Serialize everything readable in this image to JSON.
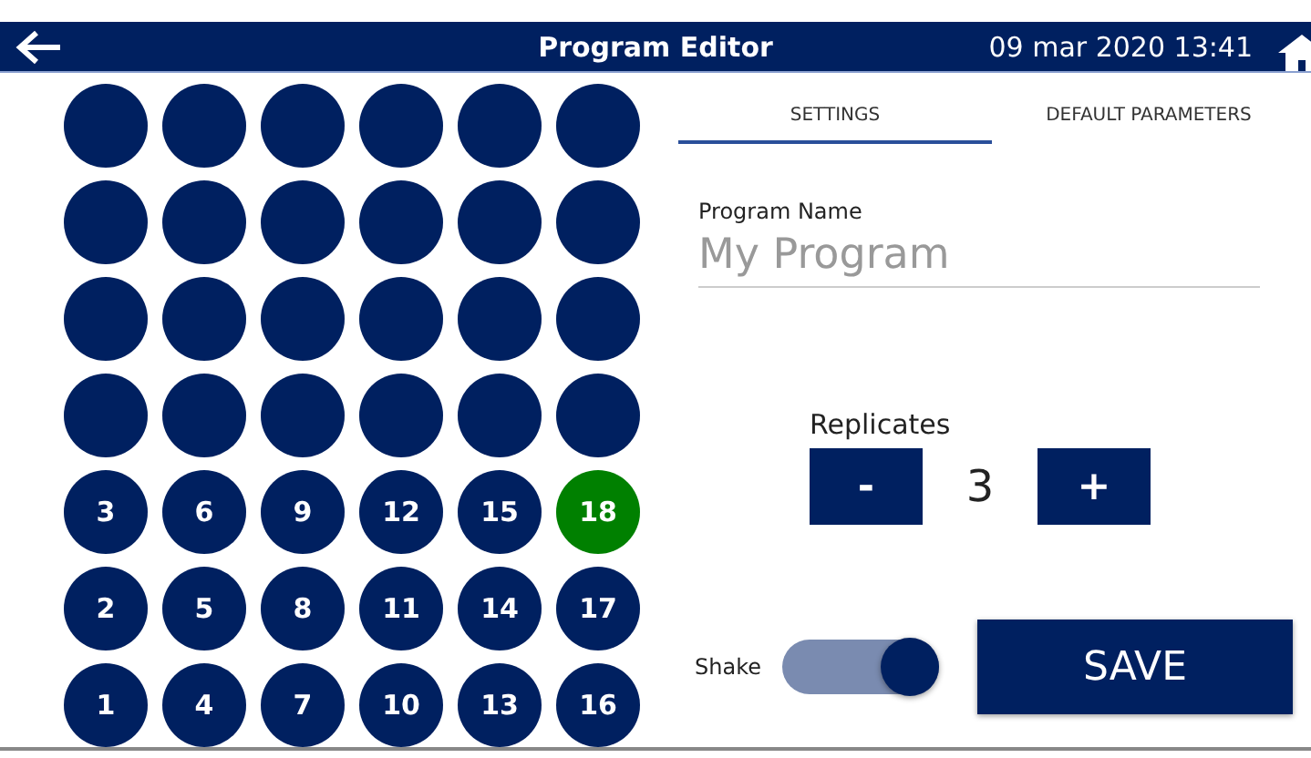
{
  "header": {
    "title": "Program Editor",
    "datetime": "09 mar 2020 13:41"
  },
  "wells": [
    {
      "selected": false
    },
    {
      "selected": false
    },
    {
      "selected": false
    },
    {
      "selected": false
    },
    {
      "selected": false
    },
    {
      "selected": false
    },
    {
      "selected": false
    },
    {
      "selected": false
    },
    {
      "selected": false
    },
    {
      "selected": false
    },
    {
      "selected": false
    },
    {
      "selected": false
    },
    {
      "selected": false
    },
    {
      "selected": false
    },
    {
      "selected": false
    },
    {
      "selected": false
    },
    {
      "selected": false
    },
    {
      "selected": false
    },
    {
      "selected": false
    },
    {
      "selected": false
    },
    {
      "selected": false
    },
    {
      "selected": false
    },
    {
      "selected": false
    },
    {
      "selected": false
    },
    {
      "label": "3",
      "selected": false
    },
    {
      "label": "6",
      "selected": false
    },
    {
      "label": "9",
      "selected": false
    },
    {
      "label": "12",
      "selected": false
    },
    {
      "label": "15",
      "selected": false
    },
    {
      "label": "18",
      "selected": true
    },
    {
      "label": "2",
      "selected": false
    },
    {
      "label": "5",
      "selected": false
    },
    {
      "label": "8",
      "selected": false
    },
    {
      "label": "11",
      "selected": false
    },
    {
      "label": "14",
      "selected": false
    },
    {
      "label": "17",
      "selected": false
    },
    {
      "label": "1",
      "selected": false
    },
    {
      "label": "4",
      "selected": false
    },
    {
      "label": "7",
      "selected": false
    },
    {
      "label": "10",
      "selected": false
    },
    {
      "label": "13",
      "selected": false
    },
    {
      "label": "16",
      "selected": false
    }
  ],
  "tabs": [
    {
      "label": "SETTINGS",
      "selected": true
    },
    {
      "label": "DEFAULT PARAMETERS",
      "selected": false
    }
  ],
  "program_name": {
    "label": "Program Name",
    "placeholder": "My Program"
  },
  "replicates": {
    "label": "Replicates",
    "decrement": "-",
    "value": "3",
    "increment": "+"
  },
  "shake": {
    "label": "Shake",
    "on": true
  },
  "save_button": "SAVE"
}
